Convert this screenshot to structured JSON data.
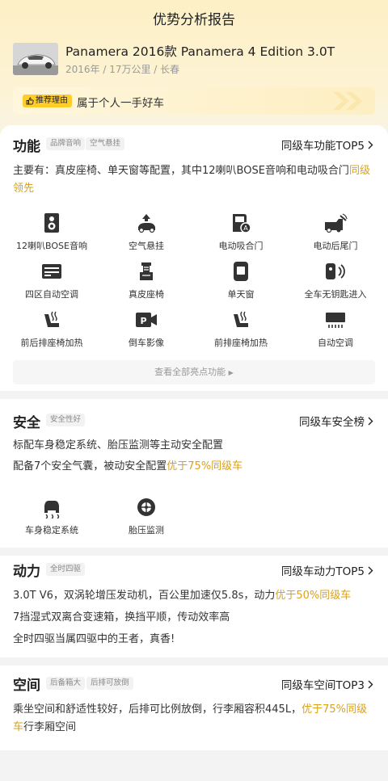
{
  "nav": {
    "title": "优势分析报告"
  },
  "car": {
    "title": "Panamera 2016款 Panamera 4 Edition 3.0T",
    "meta": "2016年 / 17万公里 / 长春"
  },
  "reason": {
    "tag": "推荐理由",
    "text": "属于个人一手好车"
  },
  "colors": {
    "accent": "#d9a21b",
    "tag_yellow": "#ffcd2a"
  },
  "function": {
    "title": "功能",
    "chips": [
      "品牌音响",
      "空气悬挂"
    ],
    "rank": "同级车功能TOP5",
    "desc_main": "主要有：真皮座椅、单天窗等配置，其中12喇叭BOSE音响和电动吸合门",
    "desc_hl": "同级领先",
    "features": [
      {
        "label": "12喇叭BOSE音响",
        "icon": "speaker-icon"
      },
      {
        "label": "空气悬挂",
        "icon": "air-suspension-icon"
      },
      {
        "label": "电动吸合门",
        "icon": "auto-door-icon"
      },
      {
        "label": "电动后尾门",
        "icon": "tailgate-icon"
      },
      {
        "label": "四区自动空调",
        "icon": "four-zone-ac-icon"
      },
      {
        "label": "真皮座椅",
        "icon": "leather-seat-icon"
      },
      {
        "label": "单天窗",
        "icon": "sunroof-icon"
      },
      {
        "label": "全车无钥匙进入",
        "icon": "keyless-entry-icon"
      },
      {
        "label": "前后排座椅加热",
        "icon": "seat-heating-icon"
      },
      {
        "label": "倒车影像",
        "icon": "parking-camera-icon"
      },
      {
        "label": "前排座椅加热",
        "icon": "front-seat-heating-icon"
      },
      {
        "label": "自动空调",
        "icon": "auto-ac-icon"
      }
    ],
    "see_all": "查看全部亮点功能"
  },
  "safety": {
    "title": "安全",
    "chips": [
      "安全性好"
    ],
    "rank": "同级车安全榜",
    "line1": "标配车身稳定系统、胎压监测等主动安全配置",
    "line2_main": "配备7个安全气囊，被动安全配置",
    "line2_hl": "优于75%同级车",
    "features": [
      {
        "label": "车身稳定系统",
        "icon": "stability-control-icon"
      },
      {
        "label": "胎压监测",
        "icon": "tire-pressure-icon"
      }
    ]
  },
  "power": {
    "title": "动力",
    "chips": [
      "全时四驱"
    ],
    "rank": "同级车动力TOP5",
    "line1_main": "3.0T V6，双涡轮增压发动机，百公里加速仅5.8s，动力",
    "line1_hl": "优于50%同级车",
    "line2": "7挡湿式双离合变速箱，换挡平顺，传动效率高",
    "line3": "全时四驱当属四驱中的王者，真香!"
  },
  "space": {
    "title": "空间",
    "chips": [
      "后备箱大",
      "后排可放倒"
    ],
    "rank": "同级车空间TOP3",
    "desc_main": "乘坐空间和舒适性较好，后排可比例放倒，行李厢容积445L，",
    "desc_hl": "优于75%同级车",
    "desc_tail": "行李厢空间"
  }
}
